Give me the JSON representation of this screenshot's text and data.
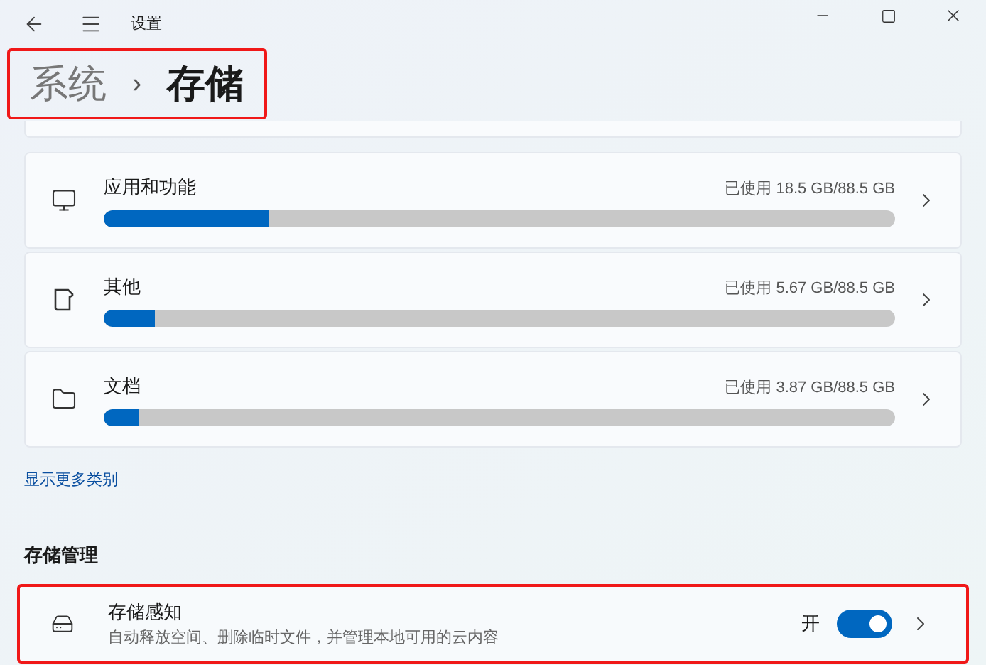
{
  "window": {
    "title": "设置"
  },
  "breadcrumb": {
    "parent": "系统",
    "separator": "›",
    "current": "存储",
    "highlighted": true
  },
  "categories": [
    {
      "kind": "apps",
      "name": "应用和功能",
      "usage": "已使用 18.5 GB/88.5 GB",
      "level": 0.209
    },
    {
      "kind": "other",
      "name": "其他",
      "usage": "已使用 5.67 GB/88.5 GB",
      "level": 0.064
    },
    {
      "kind": "documents",
      "name": "文档",
      "usage": "已使用 3.87 GB/88.5 GB",
      "level": 0.044
    }
  ],
  "more_link": "显示更多类别",
  "section_title": "存储管理",
  "storage_sense": {
    "name": "存储感知",
    "description": "自动释放空间、删除临时文件，并管理本地可用的云内容",
    "state_label": "开",
    "on": true,
    "highlighted": true
  }
}
